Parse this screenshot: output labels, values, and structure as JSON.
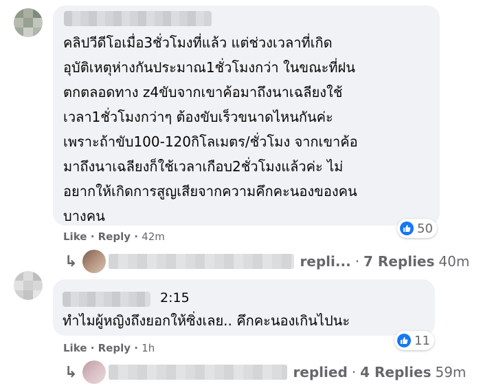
{
  "comments": [
    {
      "lines": [
        "คลิปวีดีโอเมื่อ3ชั่วโมงที่แล้ว แต่ช่วงเวลาที่เกิด",
        "อุบัติเหตุห่างกันประมาณ1ชั่วโมงกว่า ในขณะที่ฝน",
        "ตกตลอดทาง z4ขับจากเขาค้อมาถึงนาเฉลียงใช้",
        "เวลา1ชั่วโมงกว่าๆ ต้องขับเร็วขนาดไหนกันค่ะ",
        "เพราะถ้าขับ100-120กิโลเมตร/ชั่วโมง จากเขาค้อ",
        "มาถึงนาเฉลียงก็ใช้เวลาเกือบ2ชั่วโมงแล้วค่ะ ไม่",
        "อยากให้เกิดการสูญเสียจากความคึกคะนองของคน",
        "บางคน"
      ],
      "like_label": "Like",
      "reply_label": "Reply",
      "time": "42m",
      "reaction_count": "50",
      "replies": {
        "word": "repli...",
        "count": "7 Replies",
        "time": "40m"
      }
    },
    {
      "timestamp": "2:15",
      "lines": [
        "ทำไมผู้หญิงถึงยอกให้ซิ่งเลย.. คึกคะนองเกินไปนะ"
      ],
      "like_label": "Like",
      "reply_label": "Reply",
      "time": "1h",
      "reaction_count": "11",
      "replies": {
        "word": "replied",
        "count": "4 Replies",
        "time": "59m"
      }
    }
  ],
  "colors": {
    "bubble": "#f0f2f5",
    "like_blue": "#1877f2",
    "meta_gray": "#65676b"
  }
}
